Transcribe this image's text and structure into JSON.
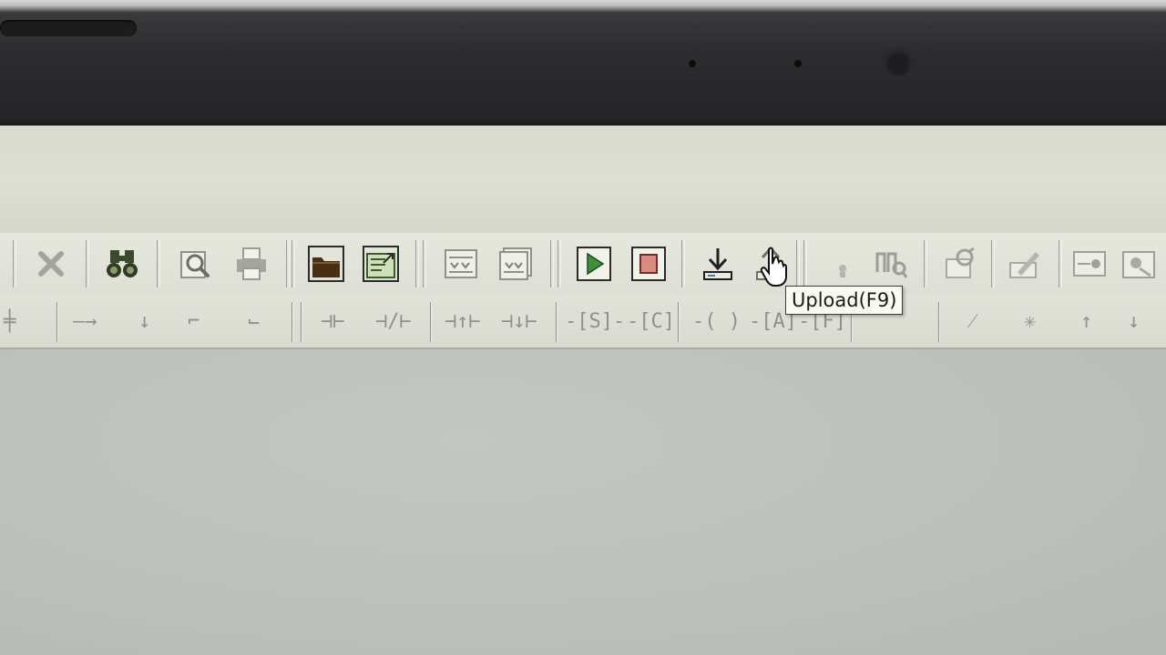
{
  "toolbar": {
    "tooltip_text": "Upload(F9)",
    "buttons": [
      {
        "name": "delete-button",
        "icon": "x-icon"
      },
      {
        "name": "find-button",
        "icon": "binoculars-icon"
      },
      {
        "name": "print-preview-button",
        "icon": "magnifier-icon"
      },
      {
        "name": "print-button",
        "icon": "printer-icon"
      },
      {
        "name": "open-folder-button",
        "icon": "folder-icon"
      },
      {
        "name": "export-button",
        "icon": "export-icon"
      },
      {
        "name": "compile-button",
        "icon": "compile-icon"
      },
      {
        "name": "compile-all-button",
        "icon": "compile-all-icon"
      },
      {
        "name": "run-button",
        "icon": "play-icon"
      },
      {
        "name": "stop-button",
        "icon": "stop-icon"
      },
      {
        "name": "download-button",
        "icon": "download-icon"
      },
      {
        "name": "upload-button",
        "icon": "upload-icon"
      },
      {
        "name": "monitor-button",
        "icon": "monitor-icon"
      },
      {
        "name": "diagnostics-button",
        "icon": "diagnostics-icon"
      },
      {
        "name": "edit-button",
        "icon": "pencil-icon"
      },
      {
        "name": "network-button",
        "icon": "network-icon"
      },
      {
        "name": "view-button",
        "icon": "view-icon"
      }
    ]
  },
  "ladder_toolbar": {
    "items": [
      {
        "name": "insert-rung-icon",
        "glyph": "╪"
      },
      {
        "name": "horizontal-line-icon",
        "glyph": "—→"
      },
      {
        "name": "vertical-line-icon",
        "glyph": "↓"
      },
      {
        "name": "branch-down-icon",
        "glyph": "⌐"
      },
      {
        "name": "branch-up-icon",
        "glyph": "⌙"
      },
      {
        "name": "contact-no-icon",
        "glyph": "⊣⊢"
      },
      {
        "name": "contact-nc-icon",
        "glyph": "⊣/⊢"
      },
      {
        "name": "positive-edge-icon",
        "glyph": "⊣↑⊢"
      },
      {
        "name": "negative-edge-icon",
        "glyph": "⊣↓⊢"
      },
      {
        "name": "set-icon",
        "glyph": "-[S]-"
      },
      {
        "name": "counter-icon",
        "glyph": "-[C]"
      },
      {
        "name": "coil-icon",
        "glyph": "-( )"
      },
      {
        "name": "function-a-icon",
        "glyph": "-[A]"
      },
      {
        "name": "function-f-icon",
        "glyph": "-[F]"
      },
      {
        "name": "diagonal-line-icon",
        "glyph": "⁄"
      },
      {
        "name": "delete-line-icon",
        "glyph": "✳"
      },
      {
        "name": "move-up-icon",
        "glyph": "↑"
      },
      {
        "name": "move-down-icon",
        "glyph": "↓"
      }
    ]
  },
  "colors": {
    "toolbar_bg": "#e4e6dc",
    "tooltip_bg": "#fbfbf2",
    "workspace_bg": "#bfc2bd",
    "play_green": "#2e7d32",
    "stop_red": "#c9574f",
    "bezel": "#2a2a2b"
  }
}
